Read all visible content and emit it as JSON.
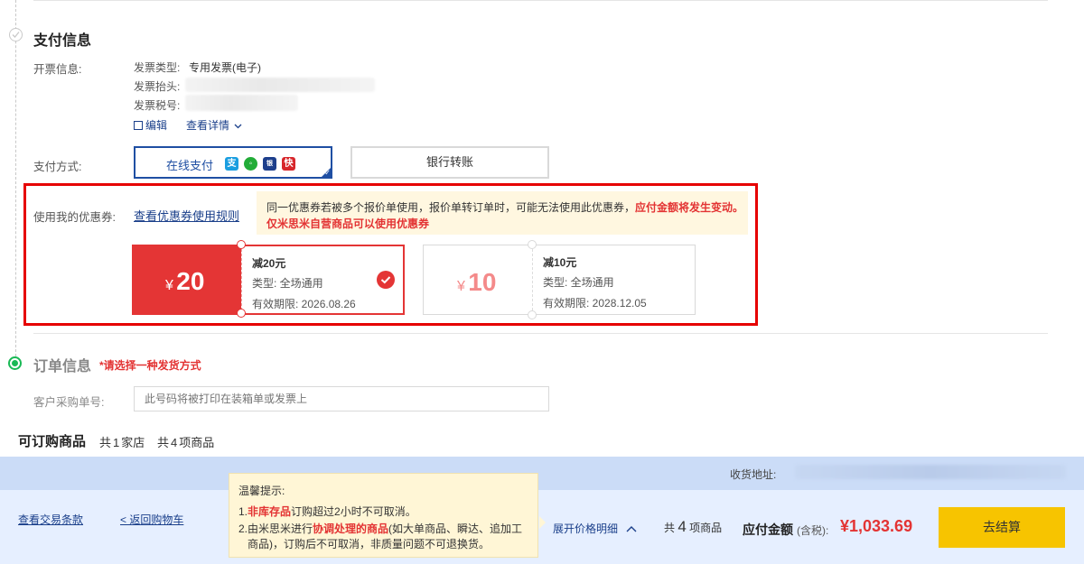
{
  "payment_section": {
    "title": "支付信息",
    "invoice": {
      "label": "开票信息:",
      "type_label": "发票类型:",
      "type_value": "专用发票(电子)",
      "title_label": "发票抬头:",
      "tax_label": "发票税号:",
      "edit_label": "编辑",
      "details_label": "查看详情"
    },
    "method_label": "支付方式:",
    "online_label": "在线支付",
    "bank_label": "银行转账"
  },
  "coupons": {
    "label": "使用我的优惠券:",
    "rules_link": "查看优惠券使用规则",
    "notice_prefix": "同一优惠券若被多个报价单使用，报价单转订单时，可能无法使用此优惠券，",
    "notice_red": "应付金额将发生变动。",
    "notice_line2": "仅米思米自营商品可以使用优惠券",
    "items": [
      {
        "symbol": "¥",
        "amount": "20",
        "title": "减20元",
        "type": "类型:  全场通用",
        "expiry": "有效期限:  2026.08.26",
        "selected": true
      },
      {
        "symbol": "¥",
        "amount": "10",
        "title": "减10元",
        "type": "类型:  全场通用",
        "expiry": "有效期限:  2028.12.05",
        "selected": false
      }
    ]
  },
  "order_section": {
    "title": "订单信息",
    "hint": "*请选择一种发货方式",
    "po_label": "客户采购单号:",
    "po_placeholder": "此号码将被打印在装箱单或发票上"
  },
  "goods": {
    "title": "可订购商品",
    "shops_prefix": "共",
    "shops_count": "1",
    "shops_suffix": "家店",
    "items_prefix": "共",
    "items_count": "4",
    "items_suffix": "项商品"
  },
  "footer": {
    "address_label": "收货地址:",
    "terms_link": "查看交易条款",
    "back_link": "< 返回购物车",
    "tip": {
      "title": "温馨提示:",
      "l1_prefix": "1.",
      "l1_red": "非库存品",
      "l1_suffix": "订购超过2小时不可取消。",
      "l2_prefix": "2.由米思米进行",
      "l2_red": "协调处理的商品",
      "l2_suffix": "(如大单商品、瞬达、追加工",
      "l3": "商品)，订购后不可取消，非质量问题不可退换货。"
    },
    "price_detail": "展开价格明细",
    "count_prefix": "共",
    "count_value": "4",
    "count_suffix": "项商品",
    "total_label": "应付金额",
    "total_note": "(含税):",
    "total_value": "¥1,033.69",
    "checkout_label": "去结算"
  },
  "colors": {
    "accent_blue": "#1f4fa3",
    "red": "#e43535",
    "green": "#19b955",
    "checkout": "#f7c400"
  }
}
